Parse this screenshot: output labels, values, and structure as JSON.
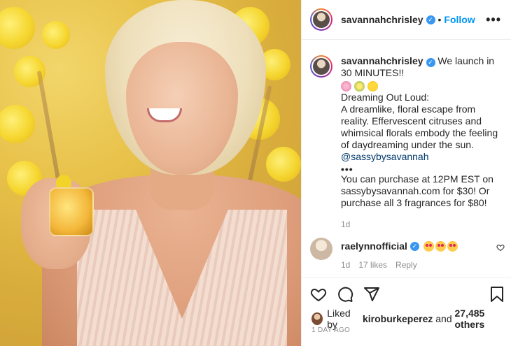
{
  "post": {
    "username": "savannahchrisley",
    "follow_label": "Follow",
    "dot": "•",
    "more": "•••"
  },
  "caption": {
    "username": "savannahchrisley",
    "line1": "We launch in 30 MINUTES!!",
    "emojis": [
      "cherry-blossom",
      "tulip-bouquet",
      "sunflower"
    ],
    "title": "Dreaming Out Loud:",
    "body": "A dreamlike, floral escape from reality. Effervescent citruses and whimsical florals embody the feeling of daydreaming under the sun.",
    "mention": "@sassybysavannah",
    "ellipsis": "•••",
    "purchase": "You can purchase at 12PM EST on sassybysavannah.com for $30! Or purchase all 3 fragrances for $80!",
    "age": "1d"
  },
  "comment": {
    "username": "raelynnofficial",
    "emojis": [
      "heart-eyes",
      "heart-eyes",
      "heart-eyes"
    ],
    "age": "1d",
    "likes": "17 likes",
    "reply": "Reply"
  },
  "likes": {
    "prefix": "Liked by",
    "user": "kiroburkeperez",
    "middle": "and",
    "others": "27,485 others"
  },
  "timestamp": "1 DAY AGO",
  "colors": {
    "accent": "#0095f6",
    "verified": "#3897f0",
    "muted": "#8e8e8e"
  }
}
